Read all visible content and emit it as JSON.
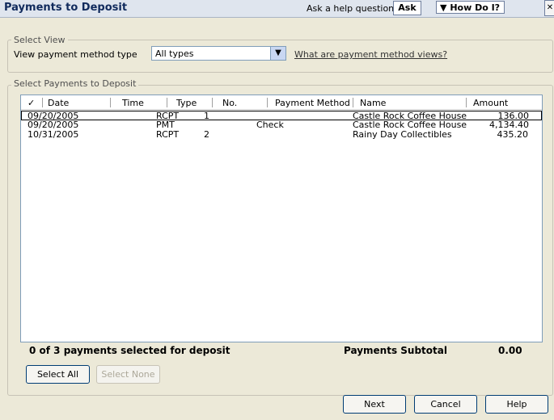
{
  "window": {
    "title": "Payments to Deposit",
    "help_prompt": "Ask a help question",
    "ask_label": "Ask",
    "howdoi_label": "How Do I?",
    "close_glyph": "✕"
  },
  "select_view": {
    "legend": "Select View",
    "label": "View payment method type",
    "selected_value": "All types",
    "link_text": "What are payment method views?"
  },
  "payments": {
    "legend": "Select Payments to Deposit",
    "columns": {
      "check": "✓",
      "date": "Date",
      "time": "Time",
      "type": "Type",
      "no": "No.",
      "method": "Payment Method",
      "name": "Name",
      "amount": "Amount"
    },
    "rows": [
      {
        "date": "09/20/2005",
        "time": "",
        "type": "RCPT",
        "no": "1",
        "method": "",
        "name": "Castle Rock Coffee House",
        "amount": "136.00"
      },
      {
        "date": "09/20/2005",
        "time": "",
        "type": "PMT",
        "no": "",
        "method": "Check",
        "name": "Castle Rock Coffee House",
        "amount": "4,134.40"
      },
      {
        "date": "10/31/2005",
        "time": "",
        "type": "RCPT",
        "no": "2",
        "method": "",
        "name": "Rainy Day Collectibles",
        "amount": "435.20"
      }
    ],
    "selected_count_text": "0 of 3 payments selected for deposit",
    "subtotal_label": "Payments Subtotal",
    "subtotal_value": "0.00"
  },
  "buttons": {
    "select_all": "Select All",
    "select_none": "Select None",
    "next": "Next",
    "cancel": "Cancel",
    "help": "Help"
  }
}
